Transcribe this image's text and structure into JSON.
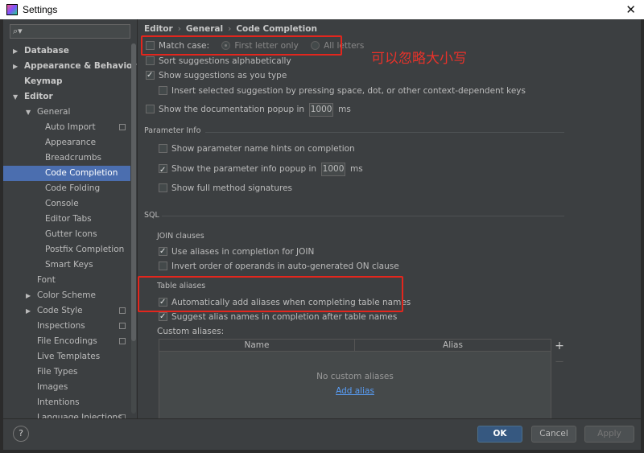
{
  "window": {
    "title": "Settings"
  },
  "search": {
    "icon": "search-icon"
  },
  "sidebar": {
    "items": [
      {
        "label": "Database",
        "depth": 0,
        "arrow": "▶",
        "bold": true
      },
      {
        "label": "Appearance & Behavior",
        "depth": 0,
        "arrow": "▶",
        "bold": true
      },
      {
        "label": "Keymap",
        "depth": 0,
        "arrow": "",
        "bold": true
      },
      {
        "label": "Editor",
        "depth": 0,
        "arrow": "▼",
        "bold": true
      },
      {
        "label": "General",
        "depth": 1,
        "arrow": "▼"
      },
      {
        "label": "Auto Import",
        "depth": 2,
        "proj": true
      },
      {
        "label": "Appearance",
        "depth": 2
      },
      {
        "label": "Breadcrumbs",
        "depth": 2
      },
      {
        "label": "Code Completion",
        "depth": 2,
        "selected": true
      },
      {
        "label": "Code Folding",
        "depth": 2
      },
      {
        "label": "Console",
        "depth": 2
      },
      {
        "label": "Editor Tabs",
        "depth": 2
      },
      {
        "label": "Gutter Icons",
        "depth": 2
      },
      {
        "label": "Postfix Completion",
        "depth": 2
      },
      {
        "label": "Smart Keys",
        "depth": 2
      },
      {
        "label": "Font",
        "depth": 1
      },
      {
        "label": "Color Scheme",
        "depth": 1,
        "arrow": "▶"
      },
      {
        "label": "Code Style",
        "depth": 1,
        "arrow": "▶",
        "proj": true
      },
      {
        "label": "Inspections",
        "depth": 1,
        "proj": true
      },
      {
        "label": "File Encodings",
        "depth": 1,
        "proj": true
      },
      {
        "label": "Live Templates",
        "depth": 1
      },
      {
        "label": "File Types",
        "depth": 1
      },
      {
        "label": "Images",
        "depth": 1
      },
      {
        "label": "Intentions",
        "depth": 1
      },
      {
        "label": "Language Injections",
        "depth": 1,
        "proj": true
      }
    ]
  },
  "breadcrumb": {
    "a": "Editor",
    "b": "General",
    "c": "Code Completion",
    "sep": "›"
  },
  "options": {
    "match_case": "Match case:",
    "first_letter": "First letter only",
    "all_letters": "All letters",
    "sort_alpha": "Sort suggestions alphabetically",
    "show_as_you_type": "Show suggestions as you type",
    "insert_selected": "Insert selected suggestion by pressing space, dot, or other context-dependent keys",
    "show_doc_popup": "Show the documentation popup in",
    "doc_popup_ms": "1000",
    "ms": "ms"
  },
  "param_info": {
    "title": "Parameter Info",
    "hints": "Show parameter name hints on completion",
    "popup": "Show the parameter info popup in",
    "popup_ms": "1000",
    "ms": "ms",
    "full_sig": "Show full method signatures"
  },
  "sql": {
    "title": "SQL",
    "join_title": "JOIN clauses",
    "use_aliases": "Use aliases in completion for JOIN",
    "invert_order": "Invert order of operands in auto-generated ON clause",
    "table_aliases_title": "Table aliases",
    "auto_add": "Automatically add aliases when completing table names",
    "suggest_alias": "Suggest alias names in completion after table names",
    "custom_aliases": "Custom aliases:",
    "col_name": "Name",
    "col_alias": "Alias",
    "no_custom": "No custom aliases",
    "add_alias": "Add alias",
    "plus": "+",
    "minus": "—"
  },
  "annotation": "可以忽略大小写",
  "buttons": {
    "help": "?",
    "ok": "OK",
    "cancel": "Cancel",
    "apply": "Apply"
  },
  "colors": {
    "accent": "#4b6eaf",
    "annotation_red": "#e3261d",
    "link": "#589df6"
  }
}
